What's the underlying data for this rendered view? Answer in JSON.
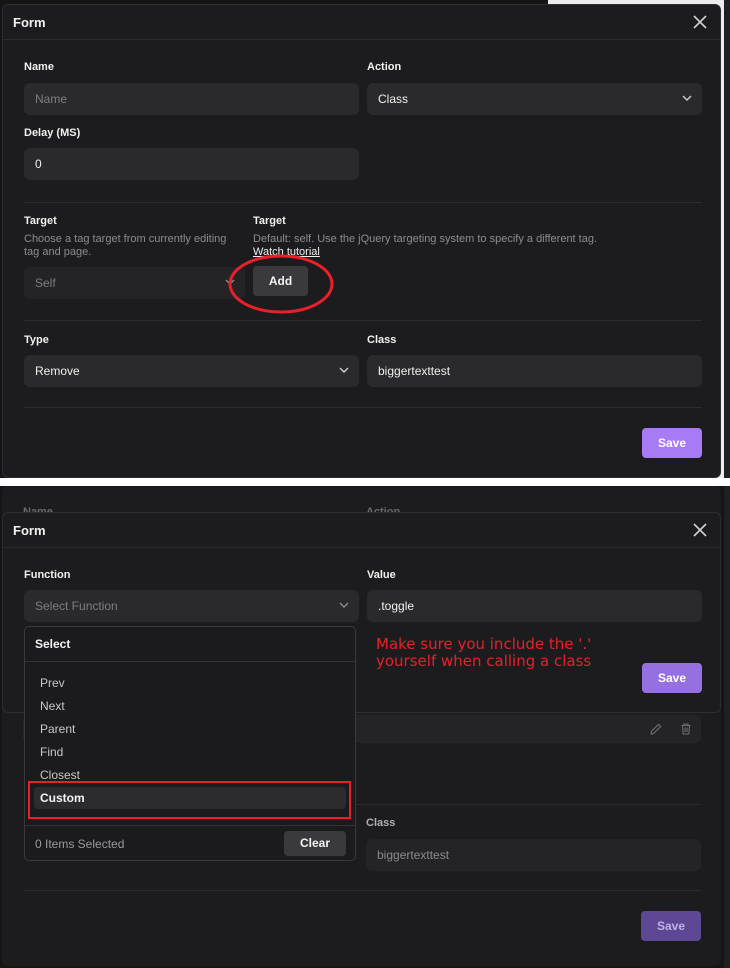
{
  "top_form": {
    "title": "Form",
    "name_label": "Name",
    "name_placeholder": "Name",
    "action_label": "Action",
    "action_value": "Class",
    "delay_label": "Delay (MS)",
    "delay_value": "0",
    "target_left_label": "Target",
    "target_left_help": "Choose a tag target from currently editing tag and page.",
    "target_left_value": "Self",
    "target_right_label": "Target",
    "target_right_help": "Default: self. Use the jQuery targeting system to specify a different tag.",
    "watch_tutorial": "Watch tutorial",
    "add_label": "Add",
    "type_label": "Type",
    "type_value": "Remove",
    "class_label": "Class",
    "class_value": "biggertexttest",
    "save_label": "Save"
  },
  "bottom_form": {
    "title": "Form",
    "function_label": "Function",
    "function_placeholder": "Select Function",
    "value_label": "Value",
    "value_value": ".toggle",
    "save_label": "Save",
    "annotation_line1": "Make sure you include the '.'",
    "annotation_line2": "yourself when calling a class",
    "behind_name_label": "Name",
    "behind_action_label": "Action",
    "behind_class_label": "Class",
    "behind_class_value": "biggertexttest",
    "behind_save_label": "Save",
    "dropdown": {
      "header": "Select",
      "options": [
        "Prev",
        "Next",
        "Parent",
        "Find",
        "Closest"
      ],
      "custom": "Custom",
      "selected_count": "0 Items Selected",
      "clear_label": "Clear"
    }
  },
  "colors": {
    "accent": "#a77bf3",
    "annotation": "#e8202a",
    "modal_bg": "#1c1c1e"
  }
}
